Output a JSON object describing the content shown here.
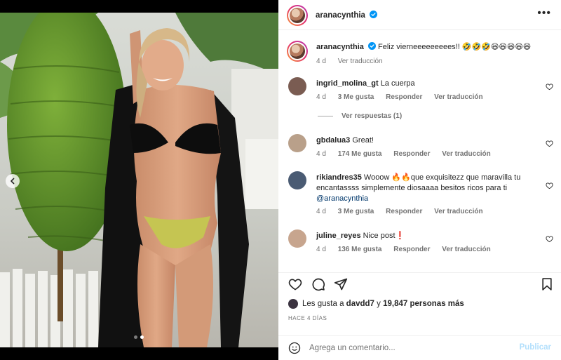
{
  "post": {
    "author": "aranacynthia",
    "more_icon": "more-horizontal-icon",
    "caption_text": "Feliz vierneeeeeeeees!! 🤣🤣🤣😆😆😆😆😆",
    "caption_age": "4 d",
    "caption_translate": "Ver traducción"
  },
  "comments": [
    {
      "user": "ingrid_molina_gt",
      "text": "La cuerpa",
      "age": "4 d",
      "likes": "3 Me gusta",
      "reply": "Responder",
      "translate": "Ver traducción",
      "view_replies": "Ver respuestas (1)"
    },
    {
      "user": "gbdalua3",
      "text": "Great!",
      "age": "4 d",
      "likes": "174 Me gusta",
      "reply": "Responder",
      "translate": "Ver traducción"
    },
    {
      "user": "rikiandres35",
      "text": "Wooow 🔥🔥que exquisitezz que maravilla tu encantassss simplemente diosaaaa besitos ricos para ti",
      "mention": "@aranacynthia",
      "age": "4 d",
      "likes": "3 Me gusta",
      "reply": "Responder",
      "translate": "Ver traducción"
    },
    {
      "user": "juline_reyes",
      "text": "Nice post❗",
      "age": "4 d",
      "likes": "136 Me gusta",
      "reply": "Responder",
      "translate": "Ver traducción"
    }
  ],
  "likes": {
    "prefix": "Les gusta a",
    "user": "davdd7",
    "connector": "y",
    "count_text": "19,847 personas más"
  },
  "timestamp": "HACE 4 DÍAS",
  "composer": {
    "placeholder": "Agrega un comentario...",
    "publish": "Publicar"
  },
  "carousel": {
    "total": 2,
    "current": 2
  },
  "colors": {
    "accent": "#0095f6",
    "verified": "#0095f6",
    "publish_disabled": "#b2dffc",
    "muted": "#737373"
  }
}
